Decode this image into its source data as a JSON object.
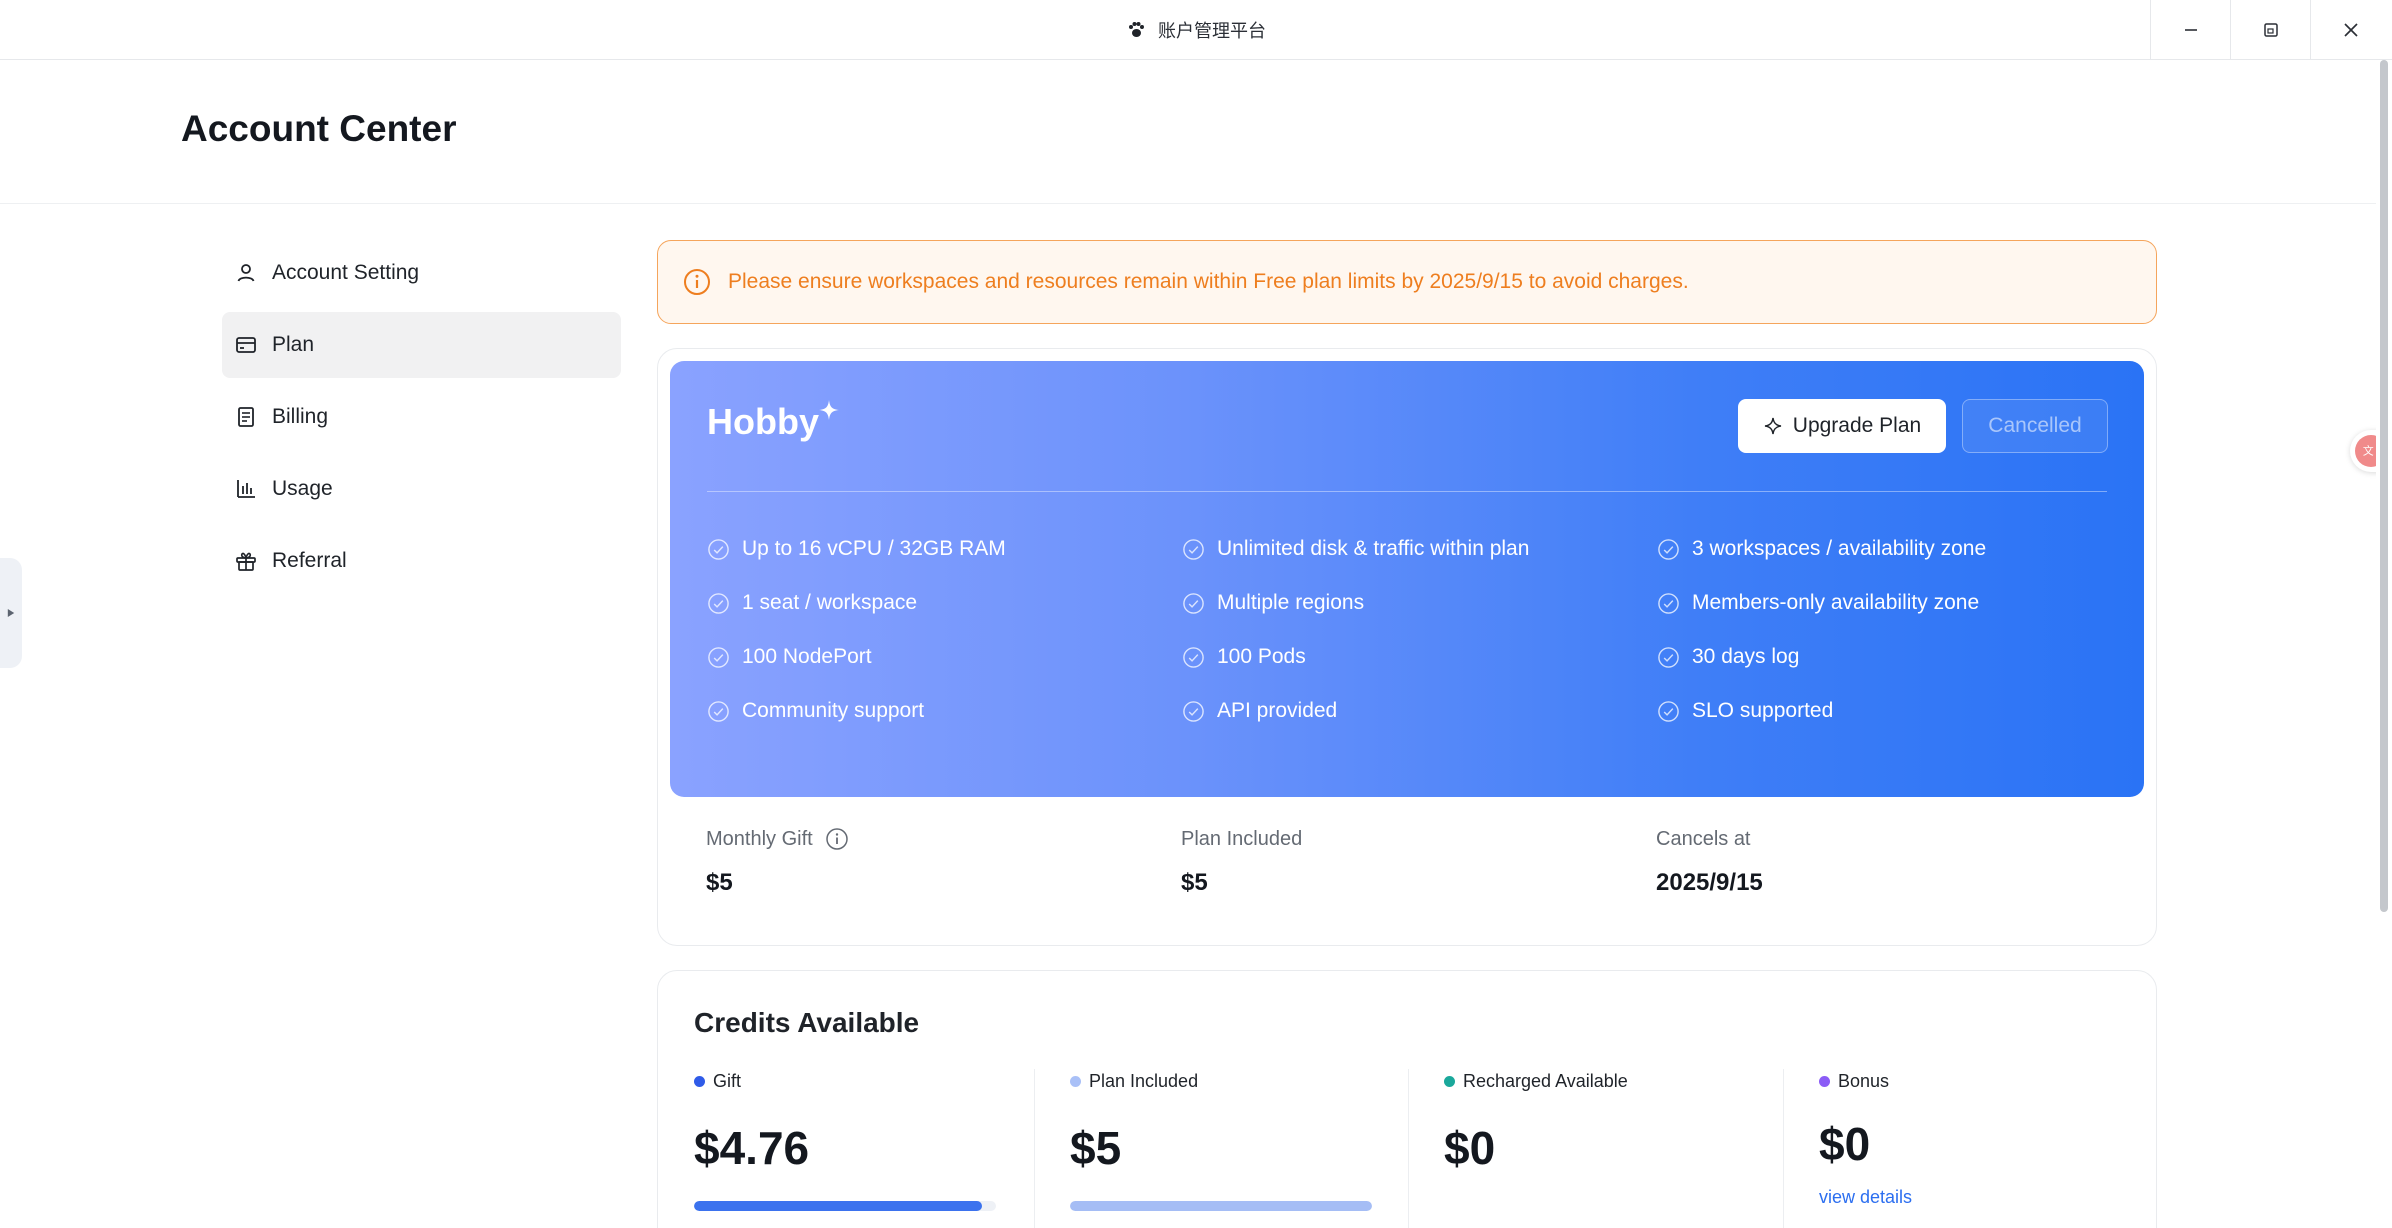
{
  "window": {
    "title": "账户管理平台"
  },
  "page": {
    "title": "Account Center"
  },
  "sidebar": {
    "items": [
      {
        "label": "Account Setting",
        "icon": "user-icon",
        "active": false
      },
      {
        "label": "Plan",
        "icon": "credit-card-icon",
        "active": true
      },
      {
        "label": "Billing",
        "icon": "receipt-icon",
        "active": false
      },
      {
        "label": "Usage",
        "icon": "bar-chart-icon",
        "active": false
      },
      {
        "label": "Referral",
        "icon": "gift-icon",
        "active": false
      }
    ]
  },
  "warning": {
    "text": "Please ensure workspaces and resources remain within Free plan limits by 2025/9/15 to avoid charges.",
    "icon": "info-circle-icon"
  },
  "plan": {
    "name": "Hobby",
    "upgrade_label": "Upgrade Plan",
    "cancelled_label": "Cancelled",
    "features": [
      "Up to 16 vCPU / 32GB RAM",
      "Unlimited disk & traffic within plan",
      "3 workspaces / availability zone",
      "1 seat / workspace",
      "Multiple regions",
      "Members-only availability zone",
      "100 NodePort",
      "100 Pods",
      "30 days log",
      "Community support",
      "API provided",
      "SLO supported"
    ],
    "stats": [
      {
        "label": "Monthly Gift",
        "value": "$5"
      },
      {
        "label": "Plan Included",
        "value": "$5"
      },
      {
        "label": "Cancels at",
        "value": "2025/9/15"
      }
    ]
  },
  "credits": {
    "title": "Credits Available",
    "items": [
      {
        "label": "Gift",
        "amount": "$4.76",
        "dot_color": "#2f5be8",
        "bar_color": "#3b72ee",
        "fill_fraction": 0.952
      },
      {
        "label": "Plan Included",
        "amount": "$5",
        "dot_color": "#a9c0f7",
        "bar_color": "#a5bdf5",
        "fill_fraction": 1.0
      },
      {
        "label": "Recharged Available",
        "amount": "$0",
        "dot_color": "#1aa89b"
      },
      {
        "label": "Bonus",
        "amount": "$0",
        "dot_color": "#8b5cf6",
        "link": "view details"
      }
    ]
  },
  "colors": {
    "accent": "#2b6ef0",
    "warning": "#ee7e1f"
  }
}
